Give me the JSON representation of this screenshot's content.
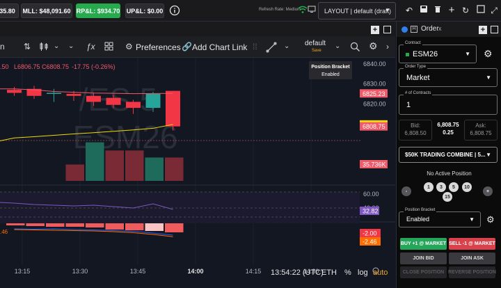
{
  "topbar": {
    "balance_partial": "35.80",
    "mll": "MLL: $48,091.60",
    "rpl": "RP&L: $934.70",
    "upl": "UP&L: $0.00",
    "refresh_text": "Refresh Rate: Medium",
    "layout_label": "LAYOUT | default (draft)"
  },
  "toolbar": {
    "indicators_label": "Preferences",
    "add_chart_link": "Add Chart Link",
    "layout_name": "default",
    "layout_save": "Save"
  },
  "chart": {
    "ohlc": {
      "l": "L6806.75",
      "c": "C6808.75",
      "change": "-17.75 (-0.26%)",
      "partial_open": ".50"
    },
    "position_bracket_title": "Position Bracket",
    "position_bracket_status": "Enabled",
    "watermark_line1": "/ES 5",
    "watermark_line2": "ESM26",
    "price_ticks": [
      "6840.00",
      "6830.00",
      "6820.00",
      "6810.00"
    ],
    "price_badges": [
      {
        "label": "6825.23",
        "color": "#f05b6a"
      },
      {
        "label": "6809.74",
        "color": "#f5d90a"
      },
      {
        "label": "6808.75",
        "color": "#f05b6a"
      },
      {
        "label": "35.736K",
        "color": "#f05b6a"
      }
    ],
    "osc_ticks": [
      "60.00",
      "40.00"
    ],
    "osc_badge": "32.82",
    "macd_badges": [
      "-2.00",
      "-2.46"
    ],
    "macd_left_label": ".46",
    "time_ticks": [
      "13:15",
      "13:30",
      "13:45",
      "14:00",
      "14:15",
      "14:30"
    ],
    "status_time": "13:54:22 (UTC)",
    "status_exchange": "ETH",
    "status_pct": "%",
    "status_log": "log",
    "status_auto": "auto"
  },
  "chart_data": {
    "type": "candlestick",
    "candles": [
      {
        "o": 6827.0,
        "h": 6828.5,
        "l": 6824.0,
        "c": 6825.5
      },
      {
        "o": 6827.5,
        "h": 6829.0,
        "l": 6822.5,
        "c": 6824.0
      },
      {
        "o": 6825.0,
        "h": 6827.5,
        "l": 6821.0,
        "c": 6825.5
      },
      {
        "o": 6825.0,
        "h": 6826.5,
        "l": 6821.5,
        "c": 6824.0
      },
      {
        "o": 6824.0,
        "h": 6825.5,
        "l": 6819.0,
        "c": 6821.0
      },
      {
        "o": 6823.0,
        "h": 6824.5,
        "l": 6818.0,
        "c": 6819.5
      },
      {
        "o": 6821.0,
        "h": 6822.0,
        "l": 6815.0,
        "c": 6818.0
      },
      {
        "o": 6818.0,
        "h": 6826.0,
        "l": 6816.0,
        "c": 6825.0
      },
      {
        "o": 6826.5,
        "h": 6826.5,
        "l": 6806.75,
        "c": 6808.75
      }
    ],
    "volumes": [
      0,
      0,
      0,
      14000,
      33000,
      26000,
      26000,
      20000,
      20000
    ],
    "volume_up": [
      false,
      false,
      false,
      false,
      true,
      false,
      false,
      true,
      false
    ],
    "ema_series": [
      6827.5,
      6827.0,
      6826.2,
      6825.8,
      6825.4,
      6825.3,
      6825.1,
      6825.2,
      6825.23
    ],
    "sma_series": [
      6803.0,
      6803.6,
      6804.3,
      6805.0,
      6805.6,
      6806.3,
      6807.0,
      6807.8,
      6809.74
    ],
    "osc_series": [
      47,
      45,
      44,
      43,
      44,
      42,
      40,
      46,
      38
    ],
    "macd_series": [
      -0.2,
      -0.3,
      -0.2,
      -0.4,
      -0.5,
      -0.7,
      -0.9,
      -1.4,
      -2.0
    ],
    "signal_series": [
      -0.4,
      -0.5,
      -0.6,
      -0.7,
      -0.8,
      -1.0,
      -1.3,
      -1.8,
      -2.46
    ],
    "hist_series": [
      -0.3,
      -0.4,
      -0.5,
      -0.5,
      -0.6,
      -0.9,
      -1.0,
      -1.1,
      -1.3
    ],
    "ylim": [
      6801,
      6842
    ]
  },
  "order": {
    "tab_label": "Order",
    "contract_label": "Contract",
    "contract_value": "ESM26",
    "order_type_label": "Order Type",
    "order_type_value": "Market",
    "contracts_label": "# of Contracts",
    "contracts_value": "1",
    "bid_label": "Bid:",
    "bid_value": "6,808.50",
    "last_value": "6,808.75",
    "spread_value": "0.25",
    "ask_label": "Ask:",
    "ask_value": "6,808.75",
    "account_value": "$50K TRADING COMBINE | 5...",
    "no_position": "No Active Position",
    "quick_qty": [
      "1",
      "3",
      "5",
      "10",
      "15"
    ],
    "bracket_label": "Position Bracket",
    "bracket_value": "Enabled",
    "buy_label": "BUY +1 @ MARKET",
    "sell_label": "SELL -1 @ MARKET",
    "join_bid": "JOIN BID",
    "join_ask": "JOIN ASK",
    "close_position": "CLOSE POSITION",
    "reverse_position": "REVERSE POSITION"
  }
}
